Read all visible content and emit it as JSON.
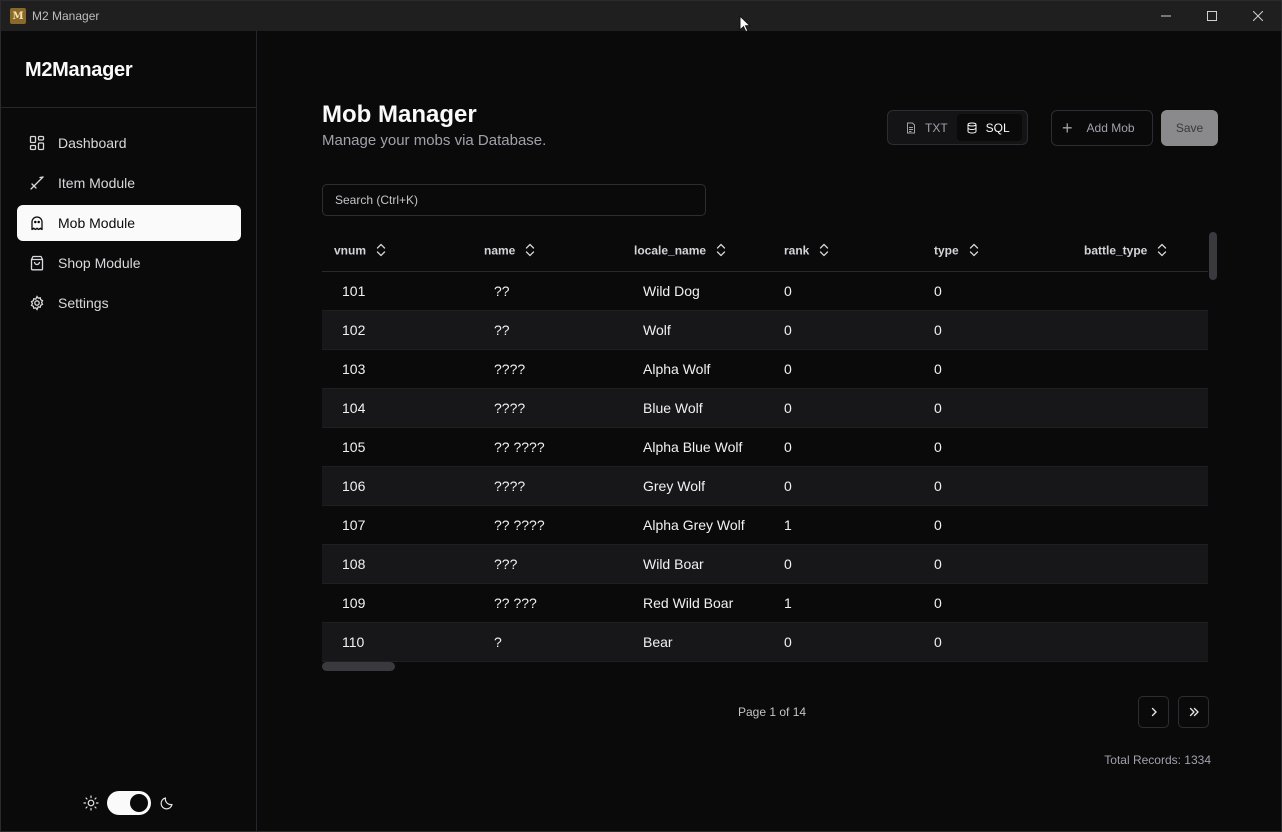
{
  "window": {
    "title": "M2 Manager"
  },
  "sidebar": {
    "brand": "M2Manager",
    "items": [
      {
        "label": "Dashboard",
        "icon": "layout-grid-icon"
      },
      {
        "label": "Item Module",
        "icon": "sword-icon"
      },
      {
        "label": "Mob Module",
        "icon": "ghost-icon",
        "active": true
      },
      {
        "label": "Shop Module",
        "icon": "shopping-bag-icon"
      },
      {
        "label": "Settings",
        "icon": "gear-icon"
      }
    ],
    "theme": {
      "mode": "dark"
    }
  },
  "header": {
    "title": "Mob Manager",
    "subtitle": "Manage your mobs via Database.",
    "mode_txt": "TXT",
    "mode_sql": "SQL",
    "active_mode": "SQL",
    "add_label": "Add Mob",
    "save_label": "Save"
  },
  "search": {
    "placeholder": "Search (Ctrl+K)"
  },
  "table": {
    "columns": [
      "vnum",
      "name",
      "locale_name",
      "rank",
      "type",
      "battle_type"
    ],
    "rows": [
      {
        "vnum": "101",
        "name": "??",
        "locale_name": "Wild Dog",
        "rank": "0",
        "type": "0"
      },
      {
        "vnum": "102",
        "name": "??",
        "locale_name": "Wolf",
        "rank": "0",
        "type": "0"
      },
      {
        "vnum": "103",
        "name": "????",
        "locale_name": "Alpha Wolf",
        "rank": "0",
        "type": "0"
      },
      {
        "vnum": "104",
        "name": "????",
        "locale_name": "Blue Wolf",
        "rank": "0",
        "type": "0"
      },
      {
        "vnum": "105",
        "name": "?? ????",
        "locale_name": "Alpha Blue Wolf",
        "rank": "0",
        "type": "0"
      },
      {
        "vnum": "106",
        "name": "????",
        "locale_name": "Grey Wolf",
        "rank": "0",
        "type": "0"
      },
      {
        "vnum": "107",
        "name": "?? ????",
        "locale_name": "Alpha Grey Wolf",
        "rank": "1",
        "type": "0"
      },
      {
        "vnum": "108",
        "name": "???",
        "locale_name": "Wild Boar",
        "rank": "0",
        "type": "0"
      },
      {
        "vnum": "109",
        "name": "?? ???",
        "locale_name": "Red Wild Boar",
        "rank": "1",
        "type": "0"
      },
      {
        "vnum": "110",
        "name": "?",
        "locale_name": "Bear",
        "rank": "0",
        "type": "0"
      }
    ]
  },
  "pagination": {
    "text": "Page 1 of 14"
  },
  "footer": {
    "total": "Total Records: 1334"
  }
}
